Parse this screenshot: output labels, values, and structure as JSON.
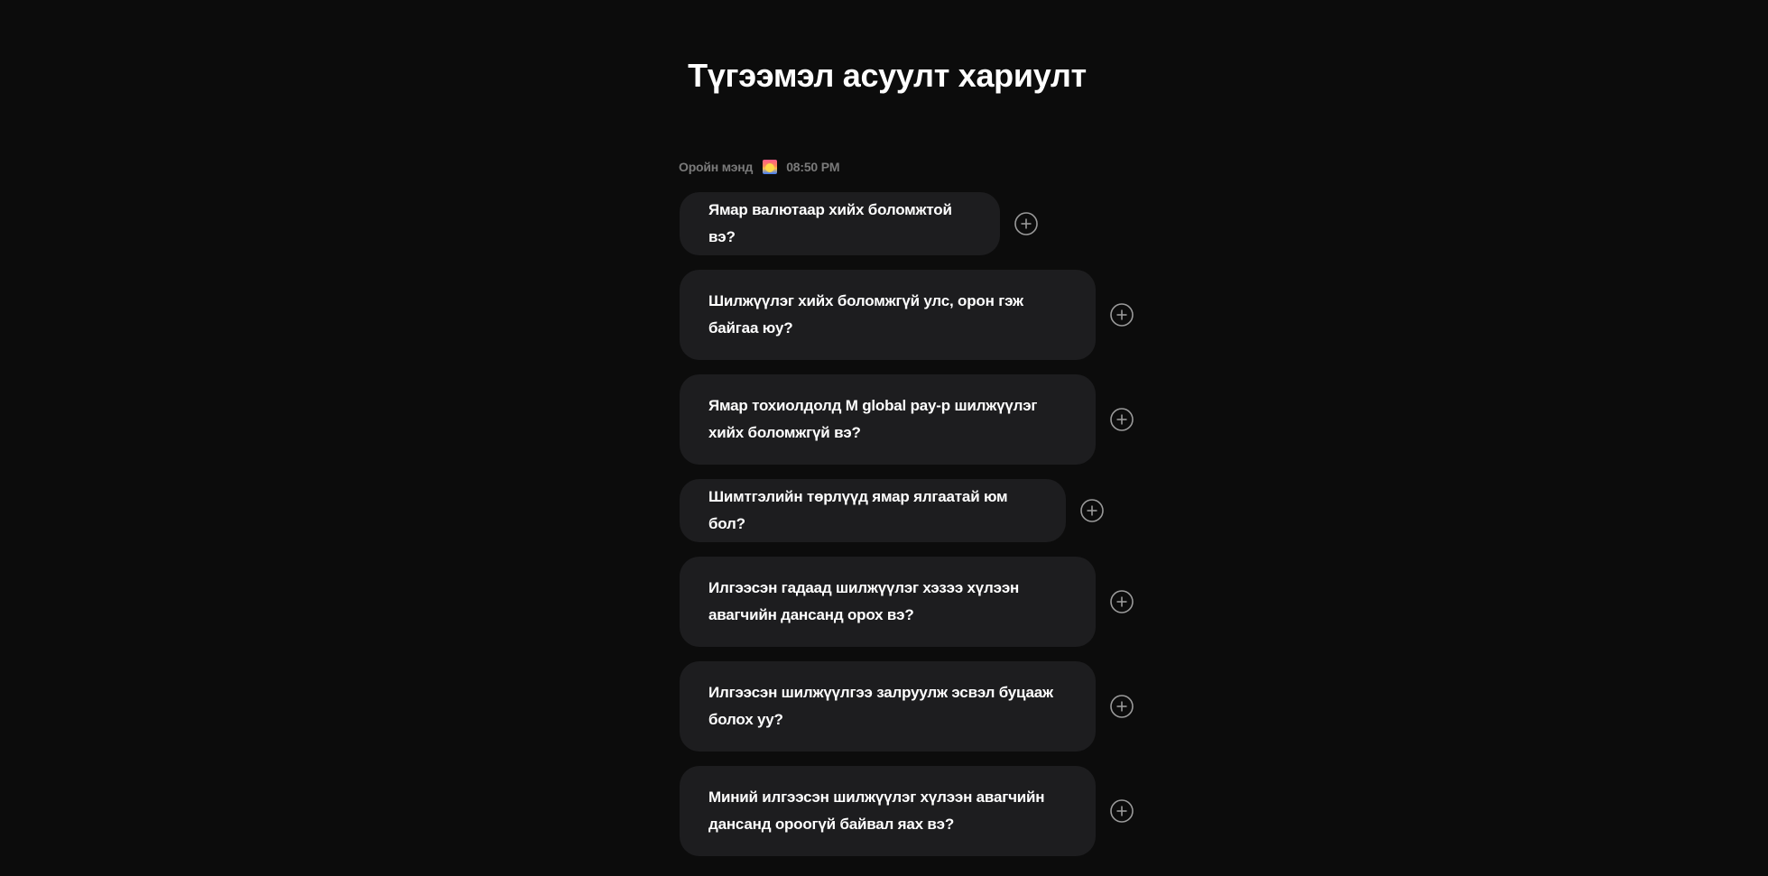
{
  "page": {
    "title": "Түгээмэл асуулт хариулт"
  },
  "greeting": {
    "text": "Оройн мэнд",
    "icon": "sunset-icon",
    "time": "08:50 PM"
  },
  "faq": {
    "items": [
      {
        "question": "Ямар валютаар хийх боломжтой вэ?"
      },
      {
        "question": "Шилжүүлэг хийх боломжгүй улс, орон гэж байгаа юу?"
      },
      {
        "question": "Ямар тохиолдолд M global pay-р шилжүүлэг хийх боломжгүй вэ?"
      },
      {
        "question": "Шимтгэлийн төрлүүд ямар ялгаатай юм бол?"
      },
      {
        "question": "Илгээсэн гадаад шилжүүлэг хэзээ хүлээн авагчийн дансанд орох вэ?"
      },
      {
        "question": "Илгээсэн шилжүүлгээ залруулж эсвэл буцааж болох уу?"
      },
      {
        "question": "Миний илгээсэн шилжүүлэг хүлээн авагчийн дансанд ороогүй байвал яах вэ?"
      }
    ],
    "expand_icon": "plus-circle-icon"
  }
}
